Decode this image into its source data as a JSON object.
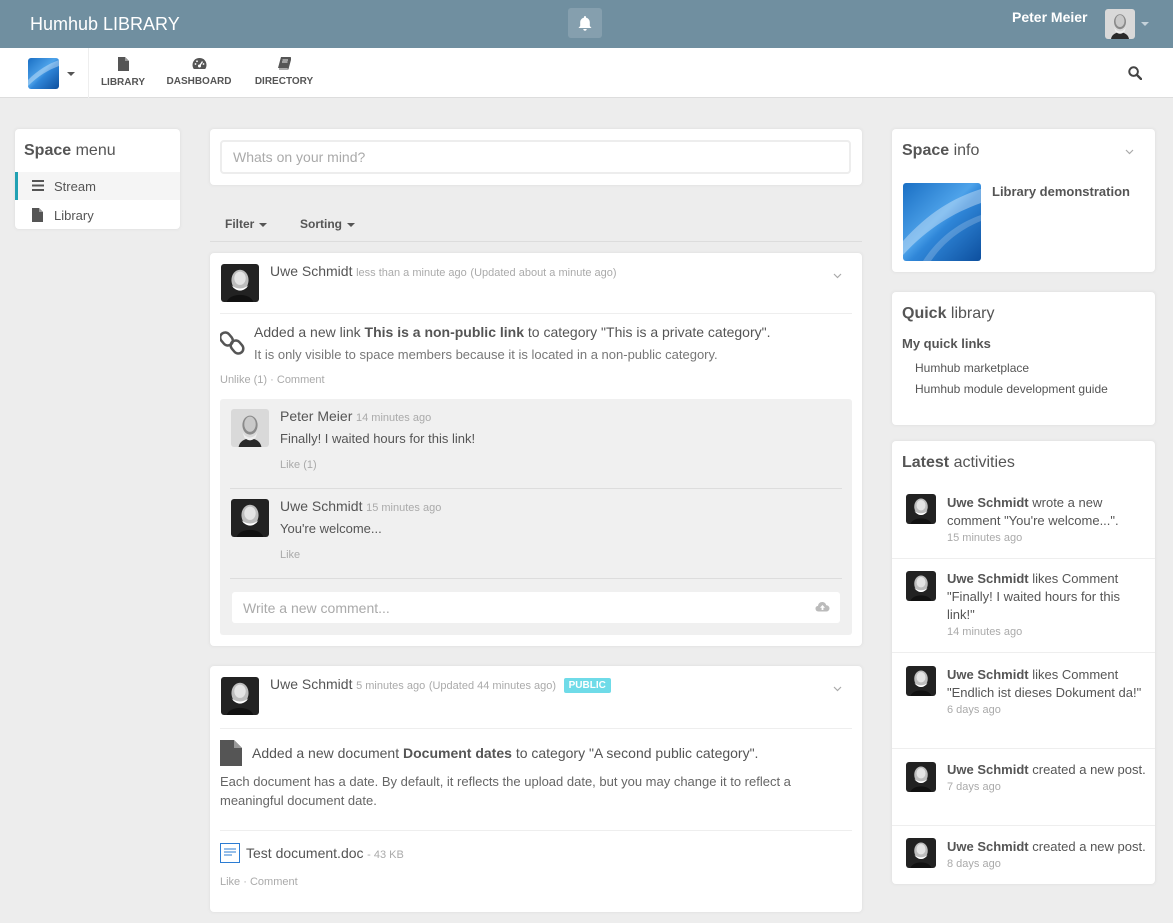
{
  "topbar": {
    "brand": "Humhub LIBRARY",
    "user_name": "Peter Meier",
    "bell_icon": "bell-icon"
  },
  "nav": {
    "items": [
      {
        "label": "LIBRARY",
        "icon": "file-icon"
      },
      {
        "label": "DASHBOARD",
        "icon": "dashboard-icon"
      },
      {
        "label": "DIRECTORY",
        "icon": "book-icon"
      }
    ],
    "search_icon": "search-icon"
  },
  "space_menu": {
    "title_bold": "Space",
    "title_rest": "menu",
    "items": [
      {
        "label": "Stream",
        "icon": "bars-icon",
        "active": true
      },
      {
        "label": "Library",
        "icon": "file-icon",
        "active": false
      }
    ]
  },
  "composer": {
    "placeholder": "Whats on your mind?"
  },
  "filters": {
    "filter_label": "Filter",
    "sorting_label": "Sorting"
  },
  "posts": [
    {
      "author": "Uwe Schmidt",
      "time": "less than a minute ago",
      "updated": "(Updated about a minute ago)",
      "text_prefix": "Added a new link",
      "link_title": "This is a non-public link",
      "text_suffix": "to category \"This is a private category\".",
      "note": "It is only visible to space members because it is located in a non-public category.",
      "actions": {
        "like": "Unlike (1)",
        "sep": "·",
        "comment": "Comment"
      },
      "comments": [
        {
          "author": "Peter Meier",
          "time": "14 minutes ago",
          "text": "Finally! I waited hours for this link!",
          "like": "Like (1)"
        },
        {
          "author": "Uwe Schmidt",
          "time": "15 minutes ago",
          "text": "You're welcome...",
          "like": "Like"
        }
      ],
      "comment_placeholder": "Write a new comment..."
    },
    {
      "author": "Uwe Schmidt",
      "time": "5 minutes ago",
      "updated": "(Updated 44 minutes ago)",
      "badge": "PUBLIC",
      "text_prefix": "Added a new document",
      "doc_title": "Document dates",
      "text_suffix": "to category \"A second public category\".",
      "description": "Each document has a date. By default, it reflects the upload date, but you may change it to reflect a meaningful document date.",
      "file_name": "Test document.doc",
      "file_size": "- 43 KB",
      "actions": {
        "like": "Like",
        "sep": "·",
        "comment": "Comment"
      }
    }
  ],
  "space_info": {
    "title_bold": "Space",
    "title_rest": "info",
    "name": "Library demonstration"
  },
  "quick_library": {
    "title_bold": "Quick",
    "title_rest": "library",
    "subtitle": "My quick links",
    "links": [
      "Humhub marketplace",
      "Humhub module development guide"
    ]
  },
  "latest": {
    "title_bold": "Latest",
    "title_rest": "activities",
    "items": [
      {
        "user": "Uwe Schmidt",
        "text": "wrote a new comment \"You're welcome...\".",
        "time": "15 minutes ago"
      },
      {
        "user": "Uwe Schmidt",
        "text": "likes Comment \"Finally! I waited hours for this link!\"",
        "time": "14 minutes ago"
      },
      {
        "user": "Uwe Schmidt",
        "text": "likes Comment \"Endlich ist dieses Dokument da!\"",
        "time": "6 days ago"
      },
      {
        "user": "Uwe Schmidt",
        "text": "created a new post.",
        "time": "7 days ago"
      },
      {
        "user": "Uwe Schmidt",
        "text": "created a new post.",
        "time": "8 days ago"
      }
    ]
  },
  "colors": {
    "topbar": "#708fa0",
    "accent": "#21a1b3",
    "badge": "#6fdbe8",
    "background": "#ededed"
  }
}
